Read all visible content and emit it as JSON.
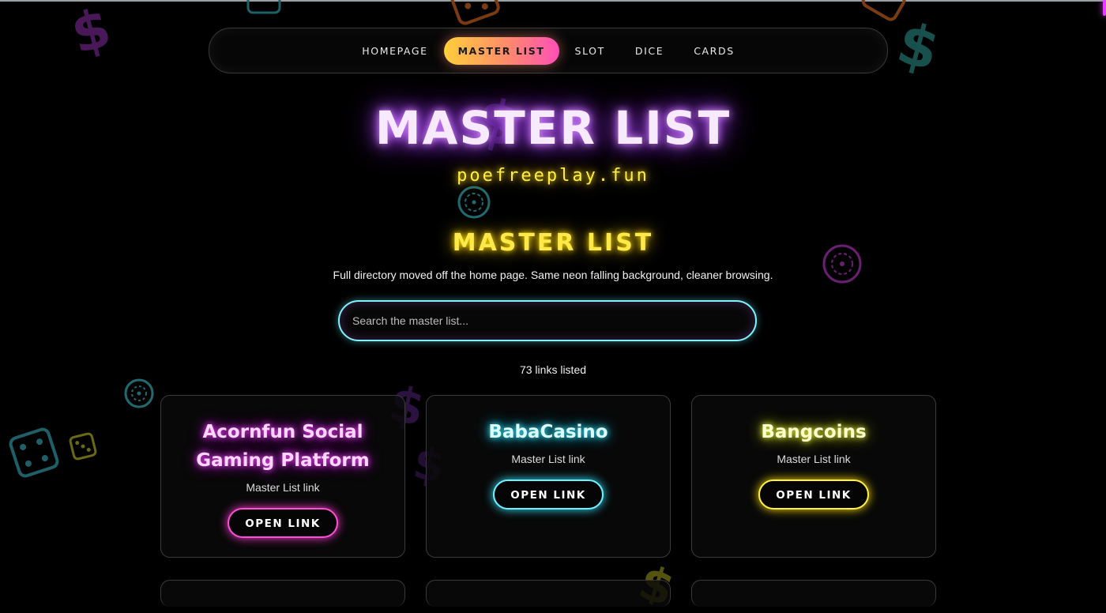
{
  "nav": {
    "items": [
      {
        "label": "HOMEPAGE",
        "active": false
      },
      {
        "label": "MASTER LIST",
        "active": true
      },
      {
        "label": "SLOT",
        "active": false
      },
      {
        "label": "DICE",
        "active": false
      },
      {
        "label": "CARDS",
        "active": false
      }
    ]
  },
  "hero": {
    "title": "MASTER LIST",
    "domain": "poefreeplay.fun"
  },
  "section": {
    "title": "MASTER LIST",
    "subtitle": "Full directory moved off the home page. Same neon falling background, cleaner browsing."
  },
  "search": {
    "placeholder": "Search the master list...",
    "value": ""
  },
  "count_label": "73 links listed",
  "cards": [
    {
      "title": "Acornfun Social Gaming Platform",
      "subtitle": "Master List link",
      "button": "OPEN LINK",
      "accent": "#ff4fd8"
    },
    {
      "title": "BabaCasino",
      "subtitle": "Master List link",
      "button": "OPEN LINK",
      "accent": "#6ff2ff"
    },
    {
      "title": "Bangcoins",
      "subtitle": "Master List link",
      "button": "OPEN LINK",
      "accent": "#fff04a"
    }
  ],
  "colors": {
    "background": "#000000",
    "nav_active_gradient": [
      "#ffcf3a",
      "#ff4fb8"
    ],
    "hero_glow": "#b24bff",
    "domain_yellow": "#ffef45",
    "search_border": "#7ff3ff"
  },
  "icons": [
    "dollar-icon",
    "dice-icon",
    "poker-chip-icon"
  ]
}
